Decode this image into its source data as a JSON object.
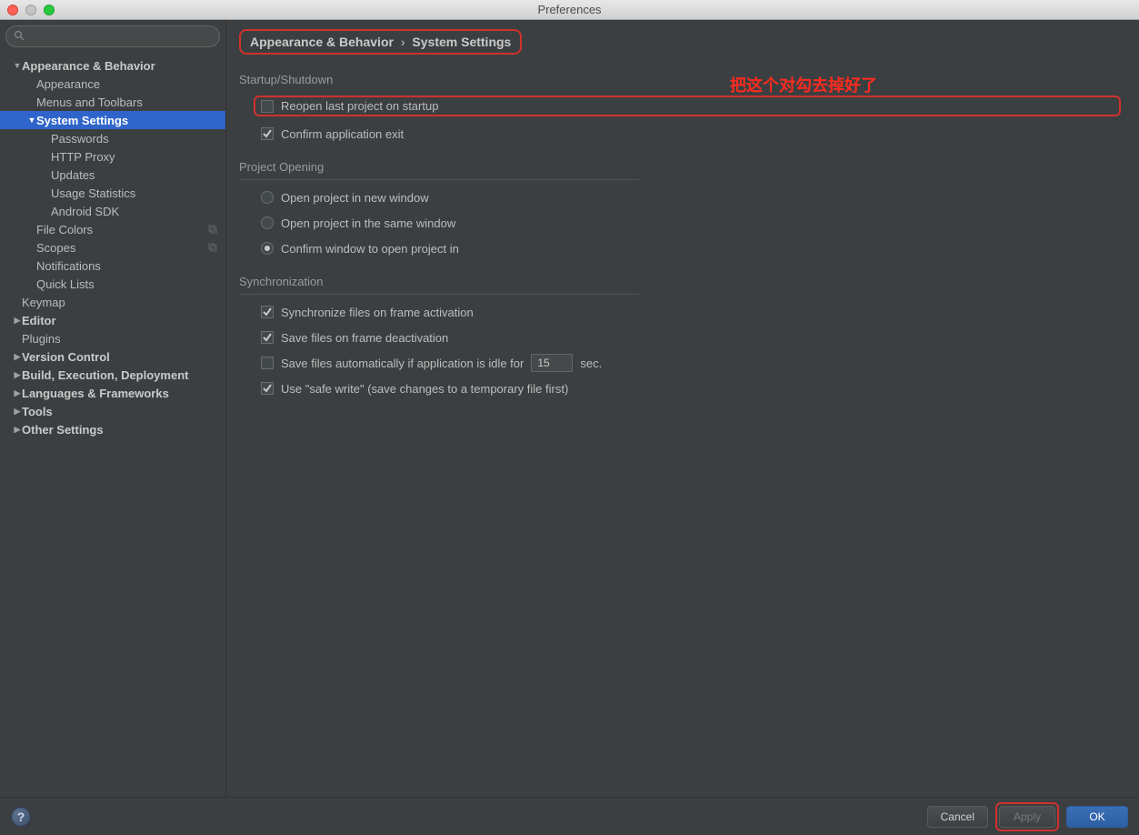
{
  "window": {
    "title": "Preferences"
  },
  "search": {
    "placeholder": ""
  },
  "sidebar": {
    "items": [
      {
        "label": "Appearance & Behavior",
        "indent": 0,
        "bold": true,
        "arrow": "down"
      },
      {
        "label": "Appearance",
        "indent": 1
      },
      {
        "label": "Menus and Toolbars",
        "indent": 1
      },
      {
        "label": "System Settings",
        "indent": 1,
        "bold": true,
        "arrow": "down",
        "selected": true
      },
      {
        "label": "Passwords",
        "indent": 2
      },
      {
        "label": "HTTP Proxy",
        "indent": 2
      },
      {
        "label": "Updates",
        "indent": 2
      },
      {
        "label": "Usage Statistics",
        "indent": 2
      },
      {
        "label": "Android SDK",
        "indent": 2
      },
      {
        "label": "File Colors",
        "indent": 1,
        "shared": true
      },
      {
        "label": "Scopes",
        "indent": 1,
        "shared": true
      },
      {
        "label": "Notifications",
        "indent": 1
      },
      {
        "label": "Quick Lists",
        "indent": 1
      },
      {
        "label": "Keymap",
        "indent": 0
      },
      {
        "label": "Editor",
        "indent": 0,
        "bold": true,
        "arrow": "right"
      },
      {
        "label": "Plugins",
        "indent": 0
      },
      {
        "label": "Version Control",
        "indent": 0,
        "bold": true,
        "arrow": "right"
      },
      {
        "label": "Build, Execution, Deployment",
        "indent": 0,
        "bold": true,
        "arrow": "right"
      },
      {
        "label": "Languages & Frameworks",
        "indent": 0,
        "bold": true,
        "arrow": "right"
      },
      {
        "label": "Tools",
        "indent": 0,
        "bold": true,
        "arrow": "right"
      },
      {
        "label": "Other Settings",
        "indent": 0,
        "bold": true,
        "arrow": "right"
      }
    ]
  },
  "breadcrumb": {
    "part1": "Appearance & Behavior",
    "separator": "›",
    "part2": "System Settings"
  },
  "annotation": "把这个对勾去掉好了",
  "sections": {
    "startup": {
      "title": "Startup/Shutdown",
      "reopen": "Reopen last project on startup",
      "confirm_exit": "Confirm application exit"
    },
    "opening": {
      "title": "Project Opening",
      "new_window": "Open project in new window",
      "same_window": "Open project in the same window",
      "confirm": "Confirm window to open project in"
    },
    "sync": {
      "title": "Synchronization",
      "sync_frame": "Synchronize files on frame activation",
      "save_deact": "Save files on frame deactivation",
      "auto_save_prefix": "Save files automatically if application is idle for",
      "auto_save_value": "15",
      "auto_save_suffix": "sec.",
      "safe_write": "Use \"safe write\" (save changes to a temporary file first)"
    }
  },
  "buttons": {
    "cancel": "Cancel",
    "apply": "Apply",
    "ok": "OK"
  },
  "help": "?"
}
